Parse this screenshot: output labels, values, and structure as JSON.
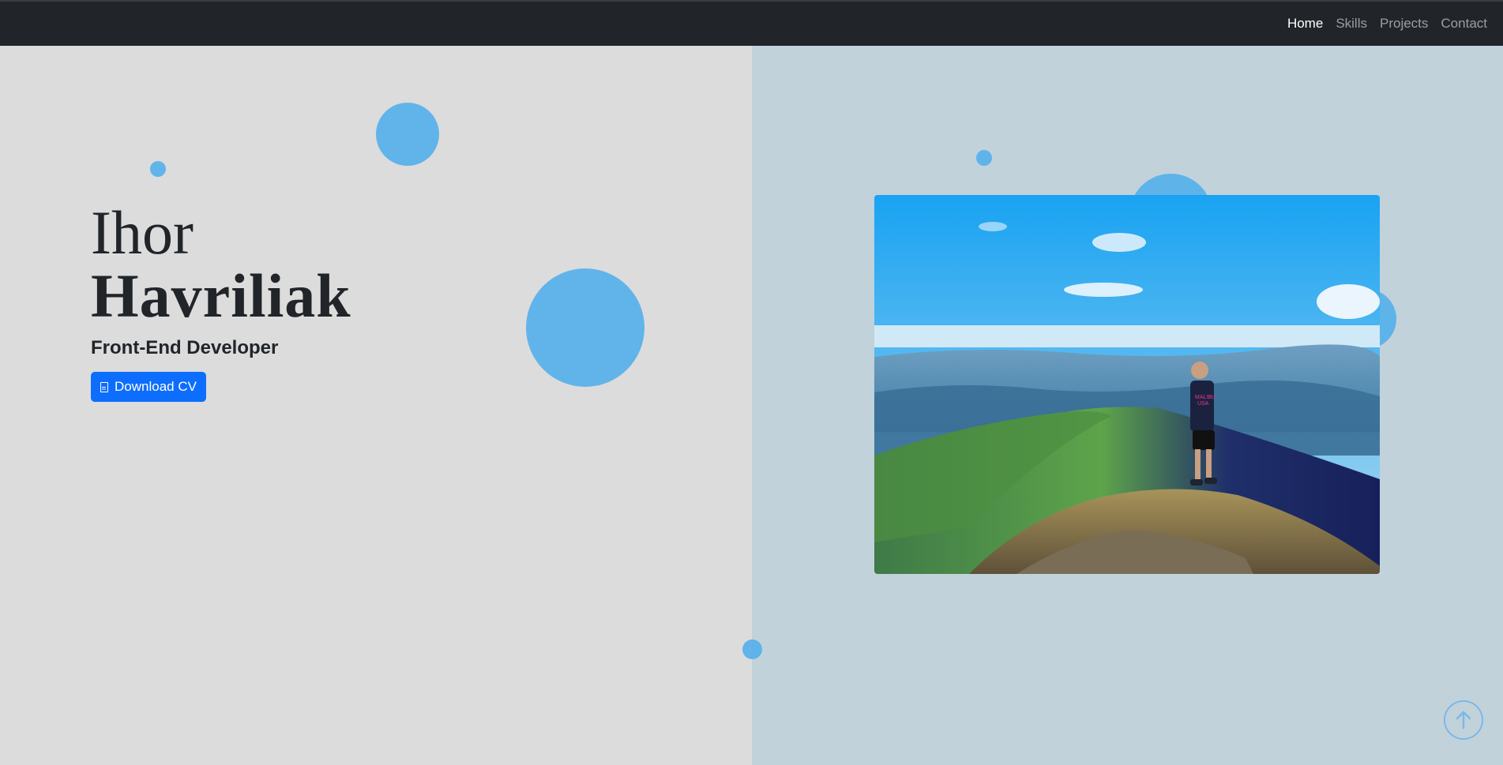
{
  "nav": {
    "items": [
      {
        "label": "Home",
        "active": true
      },
      {
        "label": "Skills",
        "active": false
      },
      {
        "label": "Projects",
        "active": false
      },
      {
        "label": "Contact",
        "active": false
      }
    ]
  },
  "hero": {
    "first_name": "Ihor",
    "last_name": "Havriliak",
    "role": "Front-End Developer",
    "cv_button_label": "Download CV",
    "cv_icon": "document-icon"
  },
  "photo": {
    "shirt_text_line1": "MALIBU",
    "shirt_text_line2": "USA"
  },
  "scroll_top_icon": "arrow-up-circle-icon",
  "colors": {
    "navbar_bg": "#212529",
    "left_bg": "#dcdcdc",
    "right_bg": "#c1d2db",
    "bubble": "#56b0ea",
    "primary_button": "#0d6efd"
  }
}
